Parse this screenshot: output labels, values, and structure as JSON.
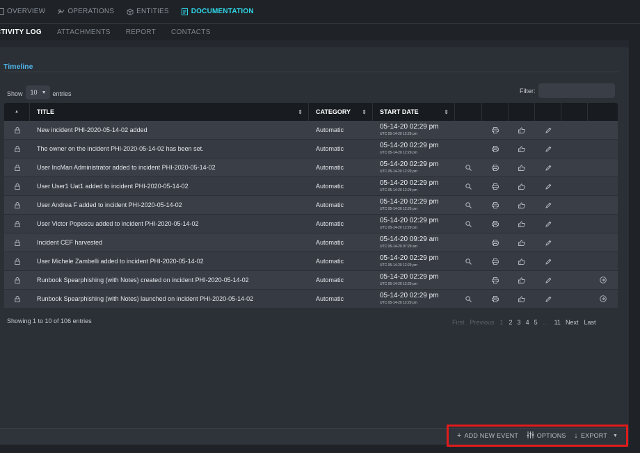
{
  "nav": {
    "tabs": [
      {
        "label": "OVERVIEW",
        "icon": "overview-icon"
      },
      {
        "label": "OPERATIONS",
        "icon": "operations-icon"
      },
      {
        "label": "ENTITIES",
        "icon": "cube-icon"
      },
      {
        "label": "DOCUMENTATION",
        "icon": "document-icon"
      }
    ],
    "active_color": "#2fd6e6",
    "subtabs": [
      "CTIVITY LOG",
      "ATTACHMENTS",
      "REPORT",
      "CONTACTS"
    ]
  },
  "timeline": {
    "title": "Timeline",
    "show_label": "Show",
    "entries_value": "10",
    "entries_label": "entries",
    "filter_label": "Filter:",
    "filter_value": ""
  },
  "table": {
    "headers": {
      "title": "TITLE",
      "category": "CATEGORY",
      "start_date": "START DATE"
    },
    "rows": [
      {
        "title": "New incident PHI-2020-05-14-02 added",
        "category": "Automatic",
        "date": "05-14-20 02:29 pm",
        "utc": "UTC 05-14-20 12:29 pm",
        "search": false,
        "flow": false
      },
      {
        "title": "The owner on the incident PHI-2020-05-14-02 has been set.",
        "category": "Automatic",
        "date": "05-14-20 02:29 pm",
        "utc": "UTC 05-14-20 12:29 pm",
        "search": false,
        "flow": false
      },
      {
        "title": "User IncMan Administrator added to incident PHI-2020-05-14-02",
        "category": "Automatic",
        "date": "05-14-20 02:29 pm",
        "utc": "UTC 05-14-20 12:29 pm",
        "search": true,
        "flow": false
      },
      {
        "title": "User User1 Uat1 added to incident PHI-2020-05-14-02",
        "category": "Automatic",
        "date": "05-14-20 02:29 pm",
        "utc": "UTC 05-14-20 12:29 pm",
        "search": true,
        "flow": false
      },
      {
        "title": "User Andrea F added to incident PHI-2020-05-14-02",
        "category": "Automatic",
        "date": "05-14-20 02:29 pm",
        "utc": "UTC 05-14-20 12:29 pm",
        "search": true,
        "flow": false
      },
      {
        "title": "User Victor Popescu added to incident PHI-2020-05-14-02",
        "category": "Automatic",
        "date": "05-14-20 02:29 pm",
        "utc": "UTC 05-14-20 12:29 pm",
        "search": true,
        "flow": false
      },
      {
        "title": "Incident CEF harvested",
        "category": "Automatic",
        "date": "05-14-20 09:29 am",
        "utc": "UTC 05-14-20 07:29 am",
        "search": false,
        "flow": false
      },
      {
        "title": "User Michele Zambelli added to incident PHI-2020-05-14-02",
        "category": "Automatic",
        "date": "05-14-20 02:29 pm",
        "utc": "UTC 05-14-20 12:29 pm",
        "search": true,
        "flow": false
      },
      {
        "title": "Runbook Spearphishing (with Notes) created on incident PHI-2020-05-14-02",
        "category": "Automatic",
        "date": "05-14-20 02:29 pm",
        "utc": "UTC 05-14-20 12:29 pm",
        "search": false,
        "flow": true
      },
      {
        "title": "Runbook Spearphishing (with Notes) launched on incident PHI-2020-05-14-02",
        "category": "Automatic",
        "date": "05-14-20 02:29 pm",
        "utc": "UTC 05-14-20 12:29 pm",
        "search": true,
        "flow": true
      }
    ]
  },
  "pagination": {
    "info": "Showing 1 to 10 of 106 entries",
    "first": "First",
    "previous": "Previous",
    "pages": [
      "1",
      "2",
      "3",
      "4",
      "5"
    ],
    "ellipsis": "…",
    "last_page": "11",
    "next": "Next",
    "last": "Last"
  },
  "actions": {
    "add": "ADD NEW EVENT",
    "options": "OPTIONS",
    "export": "EXPORT",
    "highlight_color": "#e01b1b"
  }
}
